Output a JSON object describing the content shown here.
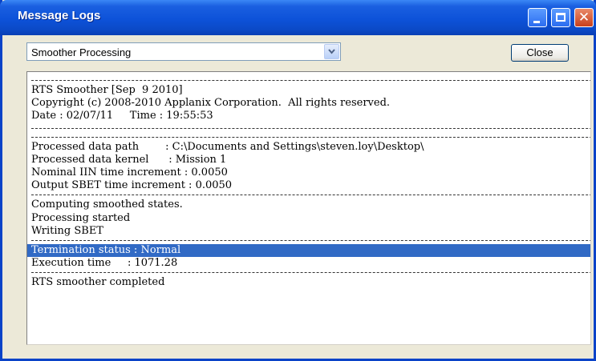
{
  "window": {
    "title": "Message Logs",
    "controls": {
      "minimize": "minimize-icon",
      "maximize": "maximize-icon",
      "close": "close-icon"
    }
  },
  "toolbar": {
    "dropdown_value": "Smoother Processing",
    "close_label": "Close"
  },
  "log": {
    "lines": [
      "RTS Smoother [Sep  9 2010]",
      "Copyright (c) 2008-2010 Applanix Corporation.  All rights reserved.",
      "Date : 02/07/11     Time : 19:55:53",
      "Processed data path        : C:\\Documents and Settings\\steven.loy\\Desktop\\",
      "Processed data kernel      : Mission 1",
      "Nominal IIN time increment : 0.0050",
      "Output SBET time increment : 0.0050",
      "Computing smoothed states.",
      "Processing started",
      "Writing SBET",
      "Termination status : Normal",
      "Execution time     : 1071.28",
      "RTS smoother completed"
    ],
    "selected_line": "Termination status : Normal"
  },
  "colors": {
    "titlebar": "#0d52d9",
    "selection": "#316ac5",
    "window_bg": "#ece9d8"
  }
}
